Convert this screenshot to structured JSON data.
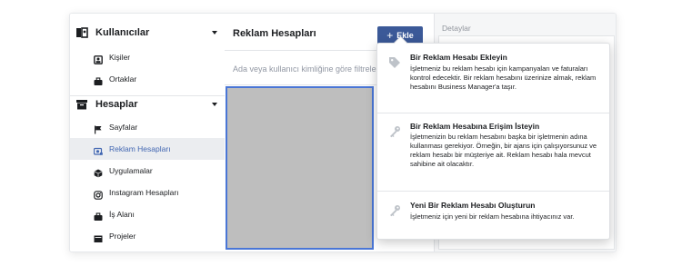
{
  "sidebar": {
    "sections": [
      {
        "label": "Kullanıcılar",
        "icon": "users-icon",
        "items": [
          {
            "label": "Kişiler",
            "icon": "person-icon"
          },
          {
            "label": "Ortaklar",
            "icon": "briefcase-icon"
          }
        ]
      },
      {
        "label": "Hesaplar",
        "icon": "accounts-icon",
        "items": [
          {
            "label": "Sayfalar",
            "icon": "flag-icon"
          },
          {
            "label": "Reklam Hesapları",
            "icon": "ad-account-icon",
            "active": true
          },
          {
            "label": "Uygulamalar",
            "icon": "app-cube-icon"
          },
          {
            "label": "Instagram Hesapları",
            "icon": "instagram-icon"
          },
          {
            "label": "İş Alanı",
            "icon": "briefcase-icon"
          },
          {
            "label": "Projeler",
            "icon": "folder-icon"
          }
        ]
      }
    ]
  },
  "main": {
    "title": "Reklam Hesapları",
    "add_button": {
      "label": "Ekle",
      "icon": "plus-icon"
    },
    "search_placeholder": "Ada veya kullanıcı kimliğine göre filtrele"
  },
  "details": {
    "title": "Detaylar"
  },
  "dropdown": {
    "options": [
      {
        "title": "Bir Reklam Hesabı Ekleyin",
        "description": "İşletmeniz bu reklam hesabı için kampanyaları ve faturaları kontrol edecektir. Bir reklam hesabını üzerinize almak, reklam hesabını Business Manager'a taşır.",
        "icon": "tag-icon"
      },
      {
        "title": "Bir Reklam Hesabına Erişim İsteyin",
        "description": "İşletmenizin bu reklam hesabını başka bir işletmenin adına kullanması gerekiyor. Örneğin, bir ajans için çalışıyorsunuz ve reklam hesabı bir müşteriye ait. Reklam hesabı hala mevcut sahibine ait olacaktır.",
        "icon": "key-icon"
      },
      {
        "title": "Yeni Bir Reklam Hesabı Oluşturun",
        "description": "İşletmeniz için yeni bir reklam hesabına ihtiyacınız var.",
        "icon": "key-icon"
      }
    ]
  },
  "colors": {
    "accent": "#3b5998",
    "active_text": "#4267b2",
    "selection_border": "#4a76d6"
  }
}
